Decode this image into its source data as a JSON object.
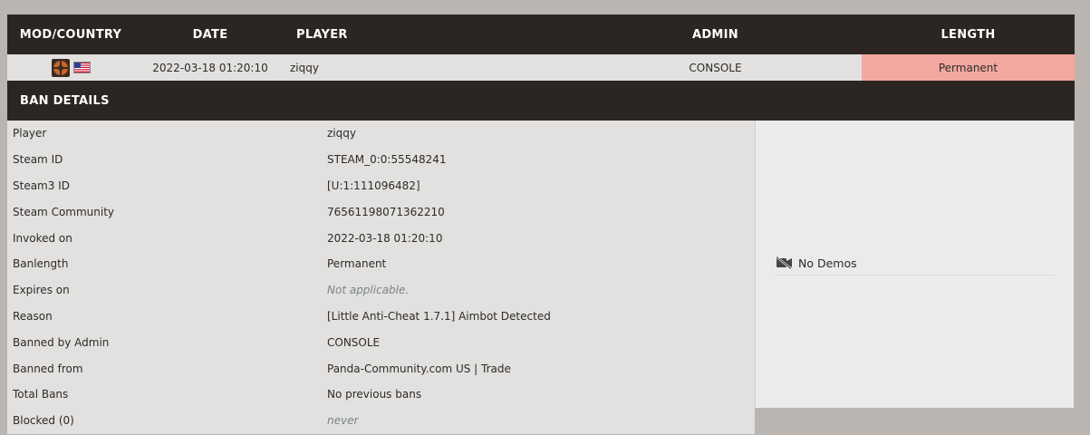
{
  "columns": {
    "mod_country": "MOD/COUNTRY",
    "date": "DATE",
    "player": "PLAYER",
    "admin": "ADMIN",
    "length": "LENGTH"
  },
  "ban": {
    "mod_icon": "tf2-game-icon",
    "country_icon": "us-flag-icon",
    "date": "2022-03-18 01:20:10",
    "player": "ziqqy",
    "admin": "CONSOLE",
    "length": "Permanent",
    "length_color": "#f2a7a0"
  },
  "details": {
    "title": "BAN DETAILS",
    "rows": [
      {
        "label": "Player",
        "value": "ziqqy"
      },
      {
        "label": "Steam ID",
        "value": "STEAM_0:0:55548241"
      },
      {
        "label": "Steam3 ID",
        "value": "[U:1:111096482]"
      },
      {
        "label": "Steam Community",
        "value": "76561198071362210"
      },
      {
        "label": "Invoked on",
        "value": "2022-03-18 01:20:10"
      },
      {
        "label": "Banlength",
        "value": "Permanent"
      },
      {
        "label": "Expires on",
        "value": "Not applicable."
      },
      {
        "label": "Reason",
        "value": "[Little Anti-Cheat 1.7.1] Aimbot Detected"
      },
      {
        "label": "Banned by Admin",
        "value": "CONSOLE"
      },
      {
        "label": "Banned from",
        "value": "Panda-Community.com US | Trade"
      },
      {
        "label": "Total Bans",
        "value": "No previous bans"
      },
      {
        "label": "Blocked (0)",
        "value": "never"
      }
    ]
  },
  "demos": {
    "icon": "video-off-icon",
    "label": "No Demos"
  },
  "colors": {
    "header_bg": "#2b2621",
    "row_bg": "#e2e1e0",
    "page_bg": "#bbb5b1",
    "muted_text": "#7a8486"
  }
}
